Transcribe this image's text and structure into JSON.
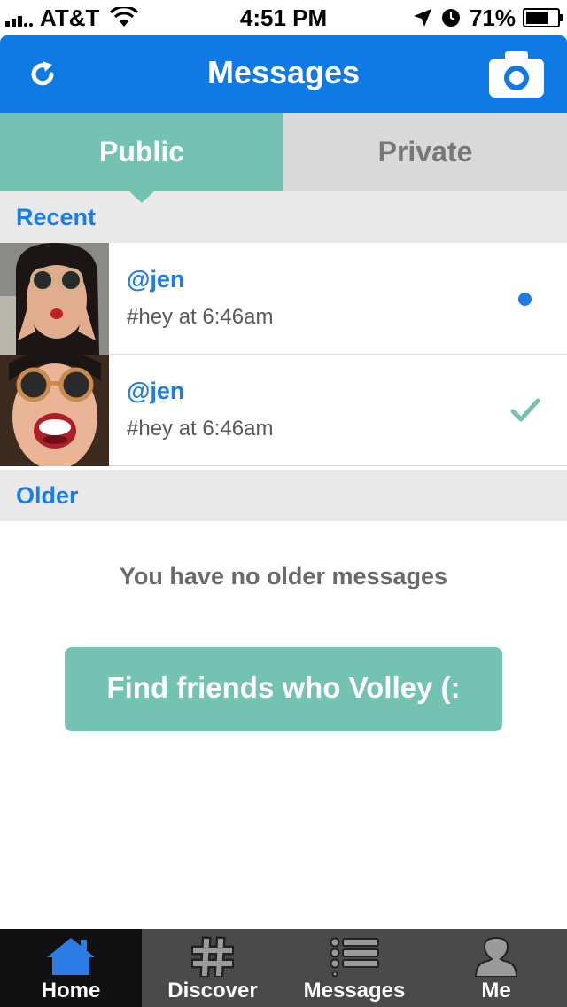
{
  "status_bar": {
    "carrier": "AT&T",
    "time": "4:51 PM",
    "battery": "71%",
    "battery_level": 0.71
  },
  "header": {
    "title": "Messages",
    "refresh_icon": "refresh-icon",
    "camera_icon": "camera-icon",
    "color": "#0f7ae6"
  },
  "tabs": [
    {
      "label": "Public",
      "active": true
    },
    {
      "label": "Private",
      "active": false
    }
  ],
  "sections": {
    "recent": "Recent",
    "older": "Older"
  },
  "messages": [
    {
      "user": "@jen",
      "text": "#hey at 6:46am",
      "status": "unread"
    },
    {
      "user": "@jen",
      "text": "#hey at 6:46am",
      "status": "read"
    }
  ],
  "empty_text": "You have no older messages",
  "find_friends_label": "Find friends who Volley (:",
  "tab_bar": [
    {
      "label": "Home",
      "icon": "home-icon",
      "active": true
    },
    {
      "label": "Discover",
      "icon": "hashtag-icon",
      "active": false
    },
    {
      "label": "Messages",
      "icon": "list-icon",
      "active": false
    },
    {
      "label": "Me",
      "icon": "person-icon",
      "active": false
    }
  ],
  "colors": {
    "accent_blue": "#1a7de8",
    "teal": "#74c2b1",
    "tab_inactive": "#d9d9d9",
    "tabbar": "#4a4a4a"
  }
}
